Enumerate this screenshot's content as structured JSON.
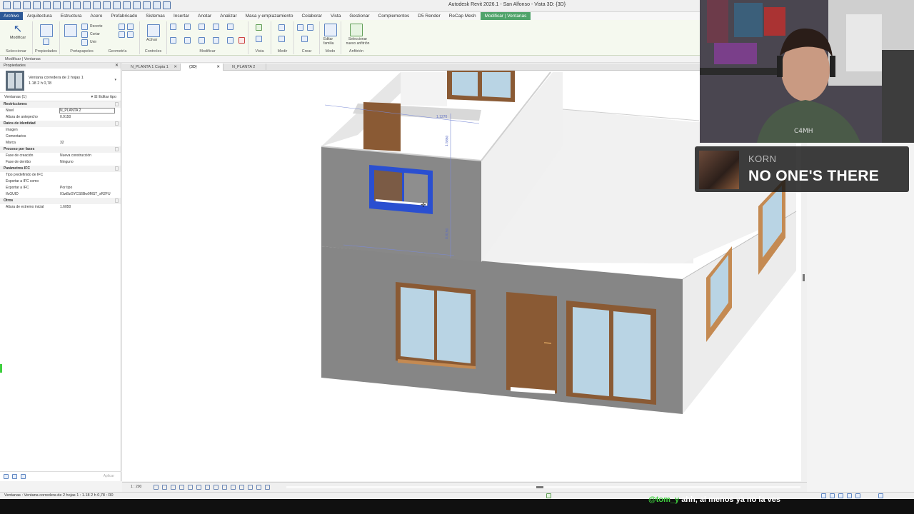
{
  "window": {
    "title": "Autodesk Revit 2026.1 - San Alfonso - Vista 3D: {3D}"
  },
  "ribbon_tabs": [
    {
      "label": "Archivo",
      "kind": "file"
    },
    {
      "label": "Arquitectura"
    },
    {
      "label": "Estructura"
    },
    {
      "label": "Acero"
    },
    {
      "label": "Prefabricado"
    },
    {
      "label": "Sistemas"
    },
    {
      "label": "Insertar"
    },
    {
      "label": "Anotar"
    },
    {
      "label": "Analizar"
    },
    {
      "label": "Masa y emplazamiento"
    },
    {
      "label": "Colaborar"
    },
    {
      "label": "Vista"
    },
    {
      "label": "Gestionar"
    },
    {
      "label": "Complementos"
    },
    {
      "label": "D5 Render"
    },
    {
      "label": "ReCap Mesh"
    },
    {
      "label": "Modificar | Ventanas",
      "kind": "active"
    }
  ],
  "ribbon": {
    "modify_label": "Modificar",
    "select_label": "Seleccionar",
    "groups": {
      "properties": "Propiedades",
      "clipboard": "Portapapeles",
      "geometry": "Geometría",
      "controls": "Controles",
      "modify": "Modificar",
      "view": "Vista",
      "measure": "Medir",
      "create": "Crear",
      "mode": "Modo",
      "host": "Anfitrión"
    },
    "small_buttons": {
      "cut": "Recorte",
      "cope": "Cortar",
      "join": "Unir",
      "activate": "Activar",
      "edit_family": "Editar familia",
      "pick_new_host": "Seleccionar nuevo anfitrión"
    }
  },
  "context_bar": "Modificar | Ventanas",
  "properties": {
    "panel_title": "Propiedades",
    "type_name_line1": "Ventana corredera de 2 hojas 1",
    "type_name_line2": "1.18 2 h 0,78",
    "filter": "Ventanas (1)",
    "edit_type": "Editar tipo",
    "rows": [
      {
        "kind": "cat",
        "name": "Restricciones"
      },
      {
        "name": "Nivel",
        "value": "N_PLANTA 2",
        "box": true
      },
      {
        "name": "Altura de antepecho",
        "value": "0.9150"
      },
      {
        "kind": "cat",
        "name": "Datos de identidad"
      },
      {
        "name": "Imagen",
        "value": ""
      },
      {
        "name": "Comentarios",
        "value": ""
      },
      {
        "name": "Marca",
        "value": "32"
      },
      {
        "kind": "cat",
        "name": "Proceso por fases"
      },
      {
        "name": "Fase de creación",
        "value": "Nueva construcción"
      },
      {
        "name": "Fase de derribo",
        "value": "Ninguno"
      },
      {
        "kind": "cat",
        "name": "Parámetros IFC"
      },
      {
        "name": "Tipo predefinido de IFC",
        "value": ""
      },
      {
        "name": "Exportar a IFC como",
        "value": ""
      },
      {
        "name": "Exportar a IFC",
        "value": "Por tipo"
      },
      {
        "name": "IfcGUID",
        "value": "01wBzGYCS6Bw0MST_sR2FU"
      },
      {
        "kind": "cat",
        "name": "Otros"
      },
      {
        "name": "Altura de extremo inicial",
        "value": "1.6050"
      }
    ],
    "apply": "Aplicar"
  },
  "view_tabs": [
    {
      "label": "N_PLANTA 1 Copia 1",
      "active": false
    },
    {
      "label": "{3D}",
      "active": true
    },
    {
      "label": "N_PLANTA 2",
      "active": false
    }
  ],
  "view": {
    "scale": "1 : 200",
    "temp_dims": [
      "1.1270",
      "1.5860",
      "0.8150",
      "0.8150"
    ]
  },
  "status_bar": "Ventanas : Ventana corredera de 2 hojas 1 : 1.18 2 h 0,78 : R0",
  "now_playing": {
    "artist": "KORN",
    "title": "NO ONE'S THERE"
  },
  "chat": {
    "user": "@tom_y",
    "message": "ahh, al menos ya no la ves"
  },
  "colors": {
    "selection_blue": "#2a4fd0",
    "wood": "#8a5a34",
    "glass": "#b9d4e4",
    "wall_front": "#868686",
    "wall_side": "#eeeeee",
    "active_tab": "#4fa36a"
  }
}
